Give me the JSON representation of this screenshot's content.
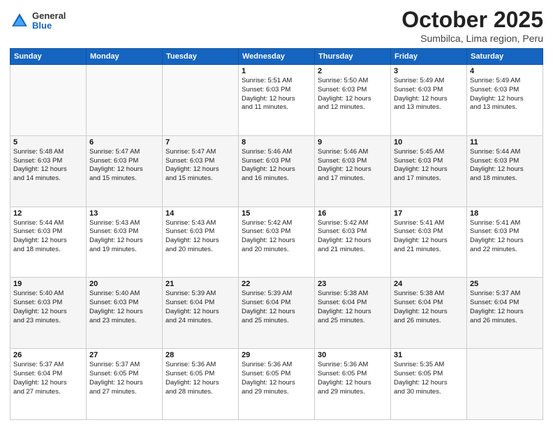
{
  "header": {
    "logo_general": "General",
    "logo_blue": "Blue",
    "month": "October 2025",
    "location": "Sumbilca, Lima region, Peru"
  },
  "days_of_week": [
    "Sunday",
    "Monday",
    "Tuesday",
    "Wednesday",
    "Thursday",
    "Friday",
    "Saturday"
  ],
  "weeks": [
    [
      {
        "day": "",
        "info": ""
      },
      {
        "day": "",
        "info": ""
      },
      {
        "day": "",
        "info": ""
      },
      {
        "day": "1",
        "info": "Sunrise: 5:51 AM\nSunset: 6:03 PM\nDaylight: 12 hours\nand 11 minutes."
      },
      {
        "day": "2",
        "info": "Sunrise: 5:50 AM\nSunset: 6:03 PM\nDaylight: 12 hours\nand 12 minutes."
      },
      {
        "day": "3",
        "info": "Sunrise: 5:49 AM\nSunset: 6:03 PM\nDaylight: 12 hours\nand 13 minutes."
      },
      {
        "day": "4",
        "info": "Sunrise: 5:49 AM\nSunset: 6:03 PM\nDaylight: 12 hours\nand 13 minutes."
      }
    ],
    [
      {
        "day": "5",
        "info": "Sunrise: 5:48 AM\nSunset: 6:03 PM\nDaylight: 12 hours\nand 14 minutes."
      },
      {
        "day": "6",
        "info": "Sunrise: 5:47 AM\nSunset: 6:03 PM\nDaylight: 12 hours\nand 15 minutes."
      },
      {
        "day": "7",
        "info": "Sunrise: 5:47 AM\nSunset: 6:03 PM\nDaylight: 12 hours\nand 15 minutes."
      },
      {
        "day": "8",
        "info": "Sunrise: 5:46 AM\nSunset: 6:03 PM\nDaylight: 12 hours\nand 16 minutes."
      },
      {
        "day": "9",
        "info": "Sunrise: 5:46 AM\nSunset: 6:03 PM\nDaylight: 12 hours\nand 17 minutes."
      },
      {
        "day": "10",
        "info": "Sunrise: 5:45 AM\nSunset: 6:03 PM\nDaylight: 12 hours\nand 17 minutes."
      },
      {
        "day": "11",
        "info": "Sunrise: 5:44 AM\nSunset: 6:03 PM\nDaylight: 12 hours\nand 18 minutes."
      }
    ],
    [
      {
        "day": "12",
        "info": "Sunrise: 5:44 AM\nSunset: 6:03 PM\nDaylight: 12 hours\nand 18 minutes."
      },
      {
        "day": "13",
        "info": "Sunrise: 5:43 AM\nSunset: 6:03 PM\nDaylight: 12 hours\nand 19 minutes."
      },
      {
        "day": "14",
        "info": "Sunrise: 5:43 AM\nSunset: 6:03 PM\nDaylight: 12 hours\nand 20 minutes."
      },
      {
        "day": "15",
        "info": "Sunrise: 5:42 AM\nSunset: 6:03 PM\nDaylight: 12 hours\nand 20 minutes."
      },
      {
        "day": "16",
        "info": "Sunrise: 5:42 AM\nSunset: 6:03 PM\nDaylight: 12 hours\nand 21 minutes."
      },
      {
        "day": "17",
        "info": "Sunrise: 5:41 AM\nSunset: 6:03 PM\nDaylight: 12 hours\nand 21 minutes."
      },
      {
        "day": "18",
        "info": "Sunrise: 5:41 AM\nSunset: 6:03 PM\nDaylight: 12 hours\nand 22 minutes."
      }
    ],
    [
      {
        "day": "19",
        "info": "Sunrise: 5:40 AM\nSunset: 6:03 PM\nDaylight: 12 hours\nand 23 minutes."
      },
      {
        "day": "20",
        "info": "Sunrise: 5:40 AM\nSunset: 6:03 PM\nDaylight: 12 hours\nand 23 minutes."
      },
      {
        "day": "21",
        "info": "Sunrise: 5:39 AM\nSunset: 6:04 PM\nDaylight: 12 hours\nand 24 minutes."
      },
      {
        "day": "22",
        "info": "Sunrise: 5:39 AM\nSunset: 6:04 PM\nDaylight: 12 hours\nand 25 minutes."
      },
      {
        "day": "23",
        "info": "Sunrise: 5:38 AM\nSunset: 6:04 PM\nDaylight: 12 hours\nand 25 minutes."
      },
      {
        "day": "24",
        "info": "Sunrise: 5:38 AM\nSunset: 6:04 PM\nDaylight: 12 hours\nand 26 minutes."
      },
      {
        "day": "25",
        "info": "Sunrise: 5:37 AM\nSunset: 6:04 PM\nDaylight: 12 hours\nand 26 minutes."
      }
    ],
    [
      {
        "day": "26",
        "info": "Sunrise: 5:37 AM\nSunset: 6:04 PM\nDaylight: 12 hours\nand 27 minutes."
      },
      {
        "day": "27",
        "info": "Sunrise: 5:37 AM\nSunset: 6:05 PM\nDaylight: 12 hours\nand 27 minutes."
      },
      {
        "day": "28",
        "info": "Sunrise: 5:36 AM\nSunset: 6:05 PM\nDaylight: 12 hours\nand 28 minutes."
      },
      {
        "day": "29",
        "info": "Sunrise: 5:36 AM\nSunset: 6:05 PM\nDaylight: 12 hours\nand 29 minutes."
      },
      {
        "day": "30",
        "info": "Sunrise: 5:36 AM\nSunset: 6:05 PM\nDaylight: 12 hours\nand 29 minutes."
      },
      {
        "day": "31",
        "info": "Sunrise: 5:35 AM\nSunset: 6:05 PM\nDaylight: 12 hours\nand 30 minutes."
      },
      {
        "day": "",
        "info": ""
      }
    ]
  ]
}
